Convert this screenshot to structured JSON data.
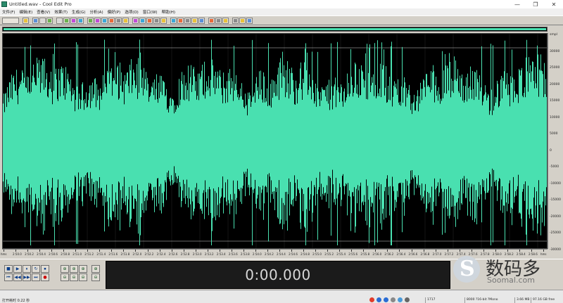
{
  "window": {
    "title": "Untitled.wav - Cool Edit Pro",
    "minimize_glyph": "—",
    "restore_glyph": "❐",
    "close_glyph": "✕"
  },
  "menu": [
    "文件(F)",
    "编辑(E)",
    "查看(V)",
    "效果(T)",
    "生成(G)",
    "分析(A)",
    "偏好(P)",
    "选项(O)",
    "窗口(W)",
    "帮助(H)"
  ],
  "amplitude_labels": [
    "smpl",
    "30000",
    "25000",
    "20000",
    "15000",
    "10000",
    "5000",
    "0",
    "-5000",
    "-10000",
    "-15000",
    "-20000",
    "-25000",
    "-30000"
  ],
  "time_labels": [
    "hms",
    "2:50.0",
    "2:50.2",
    "2:50.4",
    "2:50.6",
    "2:50.8",
    "2:51.0",
    "2:51.2",
    "2:51.4",
    "2:51.6",
    "2:51.8",
    "2:52.0",
    "2:52.2",
    "2:52.4",
    "2:52.6",
    "2:52.8",
    "2:53.0",
    "2:53.2",
    "2:53.4",
    "2:53.6",
    "2:53.8",
    "2:54.0",
    "2:54.2",
    "2:54.4",
    "2:54.6",
    "2:54.8",
    "2:55.0",
    "2:55.2",
    "2:55.4",
    "2:55.6",
    "2:55.8",
    "2:56.0",
    "2:56.2",
    "2:56.4",
    "2:56.6",
    "2:56.8",
    "2:57.0",
    "2:57.2",
    "2:57.4",
    "2:57.6",
    "2:57.8",
    "2:58.0",
    "2:58.2",
    "2:58.4",
    "2:58.6",
    "hms"
  ],
  "transport": {
    "row1": [
      "■",
      "▶",
      "⏸",
      "↻",
      "⏹"
    ],
    "row2": [
      "⏮",
      "◀◀",
      "▶▶",
      "⏭",
      "●"
    ],
    "zoom_row1": [
      "⊕",
      "⊕",
      "⊕"
    ],
    "zoom_row2": [
      "⊖",
      "⊖",
      "⊖"
    ]
  },
  "time_display": "0:00.000",
  "watermark": {
    "cn": "数码多",
    "en": "Soomal.com"
  },
  "status": {
    "left": "打开耗时 0.22 秒",
    "level": "1717",
    "format": "8000 ?16-bit ?Mono",
    "size": "3.66 MB",
    "free": "97.16 GB free"
  },
  "colors": {
    "waveform": "#49e0b0",
    "background": "#000000",
    "grid": "#2a2a2a",
    "chrome": "#d4d0c8",
    "record": "#cc0000"
  },
  "icons": {
    "app": "cool-edit-icon",
    "play": "play-icon",
    "stop": "stop-icon",
    "record": "record-icon"
  }
}
